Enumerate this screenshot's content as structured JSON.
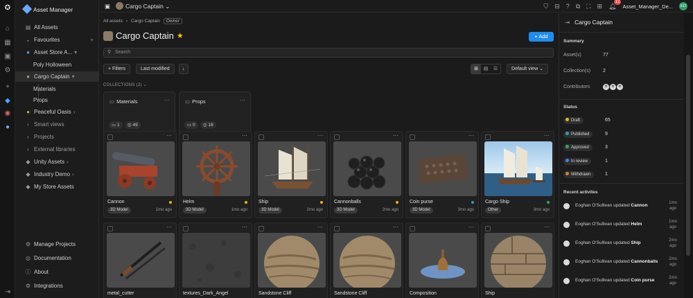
{
  "app": {
    "name": "Asset Manager"
  },
  "rail": {
    "icons": [
      "home-icon",
      "grid-icon",
      "cube-icon",
      "gear-icon",
      "plus-icon",
      "box-icon",
      "layers-icon",
      "planet-icon"
    ]
  },
  "sidebar": {
    "all_assets": "All Assets",
    "favourites": "Favourites",
    "fav_items": [
      "Asset Store A...",
      "Poly Holloween",
      "Cargo Captain"
    ],
    "cargo_children": [
      "Materials",
      "Props"
    ],
    "other_items": [
      "Peaceful Oasis",
      "Smart views",
      "Projects",
      "External libraries",
      "Unity Assets",
      "Industry Demo",
      "My Store Assets"
    ],
    "bottom": [
      "Manage Projects",
      "Documentation",
      "About",
      "Integrations"
    ]
  },
  "topbar": {
    "project": "Cargo Captain",
    "notifications": "12",
    "user": "Asset_Manager_De...",
    "avatar": "EO"
  },
  "main": {
    "breadcrumb": [
      "All assets",
      "Cargo Captain"
    ],
    "owner_badge": "Owner",
    "title": "Cargo Captain",
    "add_label": "+ Add",
    "search_placeholder": "Search",
    "filters_label": "+ Filters",
    "sort_label": "Last modified",
    "view_label": "Default view",
    "collections_heading": "COLLECTIONS (2)",
    "collections": [
      {
        "name": "Materials",
        "folders": "1",
        "items": "49"
      },
      {
        "name": "Props",
        "folders": "0",
        "items": "18"
      }
    ],
    "assets": [
      {
        "name": "Cannon",
        "type": "3D Model",
        "ago": "1mo ago",
        "status_color": "#e5b41a",
        "thumb": "cannon"
      },
      {
        "name": "Helm",
        "type": "3D Model",
        "ago": "1mo ago",
        "status_color": "#e5b41a",
        "thumb": "helm"
      },
      {
        "name": "Ship",
        "type": "3D Model",
        "ago": "2mo ago",
        "status_color": "#e5b41a",
        "thumb": "ship"
      },
      {
        "name": "Cannonballs",
        "type": "3D Model",
        "ago": "2mo ago",
        "status_color": "#e5b41a",
        "thumb": "balls"
      },
      {
        "name": "Coin purse",
        "type": "3D Model",
        "ago": "3mo ago",
        "status_color": "#2a9fb8",
        "thumb": "purse"
      },
      {
        "name": "Cargo Ship",
        "type": "Other",
        "ago": "3mo ago",
        "status_color": "#2faa66",
        "thumb": "cargoship"
      },
      {
        "name": "metal_cutter",
        "type": "",
        "ago": "",
        "status_color": "",
        "thumb": "cutter"
      },
      {
        "name": "textures_Dark_Angel",
        "type": "",
        "ago": "",
        "status_color": "",
        "thumb": "texture"
      },
      {
        "name": "Sandstone Cliff",
        "type": "",
        "ago": "",
        "status_color": "",
        "thumb": "sand"
      },
      {
        "name": "Sandstone Cliff",
        "type": "",
        "ago": "",
        "status_color": "",
        "thumb": "sand"
      },
      {
        "name": "Composition",
        "type": "",
        "ago": "",
        "status_color": "",
        "thumb": "comp"
      },
      {
        "name": "Ship",
        "type": "",
        "ago": "",
        "status_color": "",
        "thumb": "wood"
      }
    ]
  },
  "panel": {
    "title": "Cargo Captain",
    "summary_heading": "Summary",
    "assets_label": "Asset(s)",
    "assets_value": "77",
    "collections_label": "Collection(s)",
    "collections_value": "2",
    "contributors_label": "Contributors",
    "status_heading": "Status",
    "statuses": [
      {
        "label": "Draft",
        "count": "65",
        "color": "#e5b41a"
      },
      {
        "label": "Published",
        "count": "9",
        "color": "#2a9fb8"
      },
      {
        "label": "Approved",
        "count": "3",
        "color": "#2faa66"
      },
      {
        "label": "In review",
        "count": "1",
        "color": "#3b82f6"
      },
      {
        "label": "Withdrawn",
        "count": "1",
        "color": "#e07b2a"
      }
    ],
    "activities_heading": "Recent activites",
    "activities": [
      {
        "text": "Eoghan O'Sullivan updated ",
        "bold": "Cannon",
        "time": "1mo ago"
      },
      {
        "text": "Eoghan O'Sullivan updated ",
        "bold": "Helm",
        "time": "1mo ago"
      },
      {
        "text": "Eoghan O'Sullivan updated ",
        "bold": "Ship",
        "time": "2mo ago"
      },
      {
        "text": "Eoghan O'Sullivan updated ",
        "bold": "Cannonballs",
        "time": "2mo ago"
      },
      {
        "text": "Eoghan O'Sullivan updated ",
        "bold": "Coin purse",
        "time": "2mo ago"
      }
    ]
  }
}
